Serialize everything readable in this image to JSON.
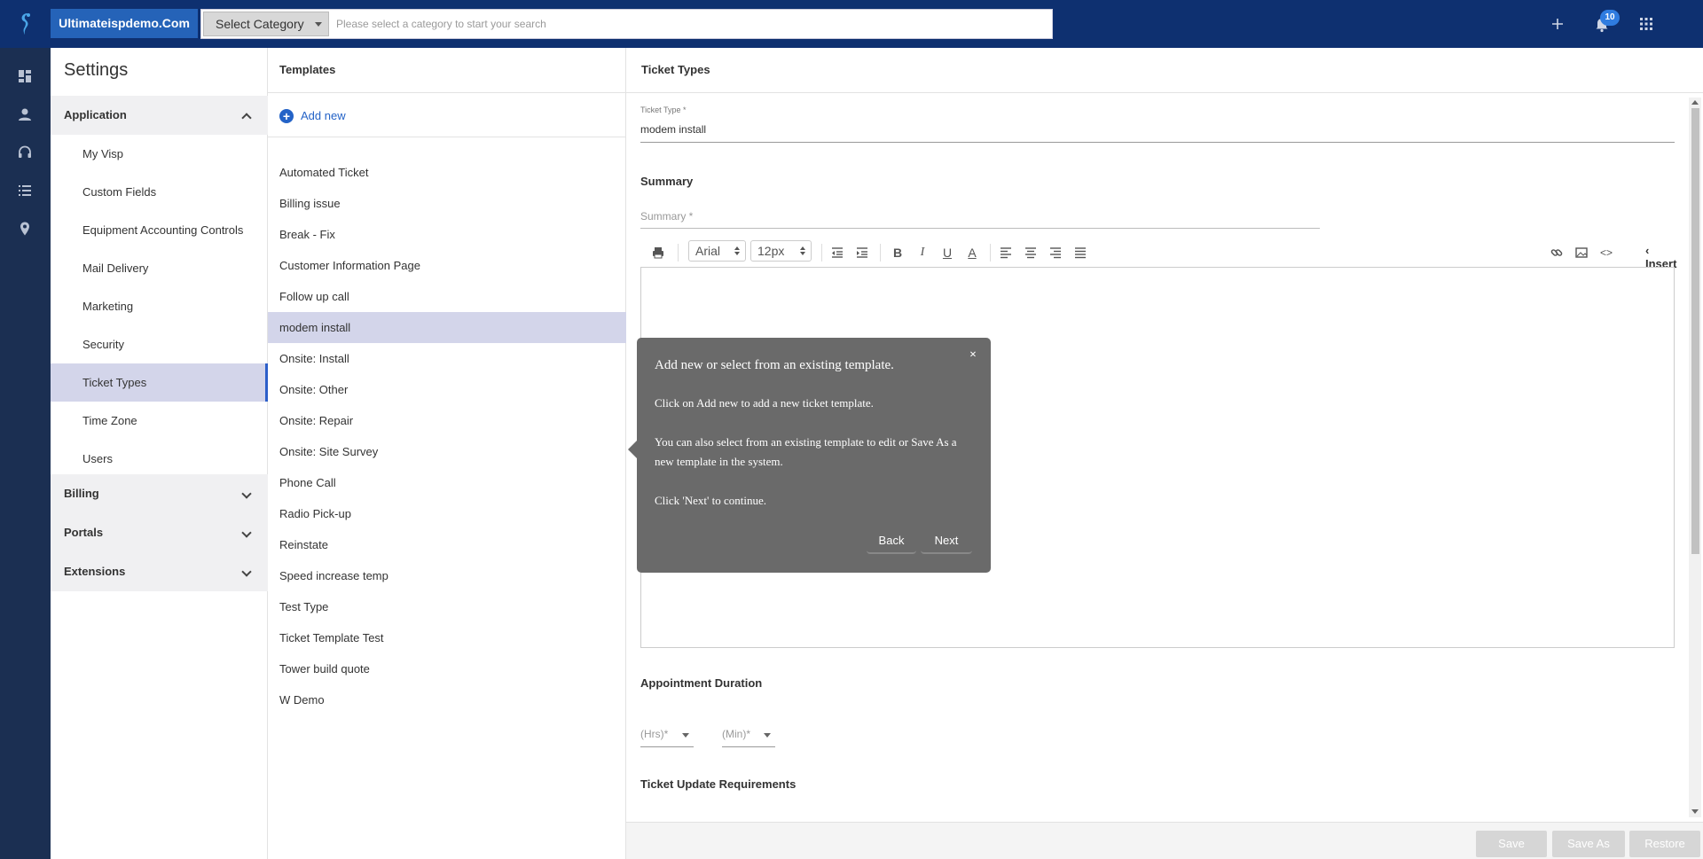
{
  "topbar": {
    "brand": "Ultimateispdemo.Com",
    "category_select": "Select Category",
    "search_placeholder": "Please select a category to start your search",
    "notification_count": "10"
  },
  "settings": {
    "title": "Settings",
    "sections": [
      {
        "label": "Application",
        "expanded": true
      },
      {
        "label": "Billing",
        "expanded": false
      },
      {
        "label": "Portals",
        "expanded": false
      },
      {
        "label": "Extensions",
        "expanded": false
      }
    ],
    "application_items": [
      {
        "label": "My Visp"
      },
      {
        "label": "Custom Fields"
      },
      {
        "label": "Equipment Accounting Controls"
      },
      {
        "label": "Mail Delivery"
      },
      {
        "label": "Marketing"
      },
      {
        "label": "Security"
      },
      {
        "label": "Ticket Types",
        "active": true
      },
      {
        "label": "Time Zone"
      },
      {
        "label": "Users"
      }
    ]
  },
  "templates": {
    "title": "Templates",
    "add_new": "Add new",
    "items": [
      "Automated Ticket",
      "Billing issue",
      "Break - Fix",
      "Customer Information Page",
      "Follow up call",
      "modem install",
      "Onsite: Install",
      "Onsite: Other",
      "Onsite: Repair",
      "Onsite: Site Survey",
      "Phone Call",
      "Radio Pick-up",
      "Reinstate",
      "Speed increase temp",
      "Test Type",
      "Ticket Template Test",
      "Tower build quote",
      "W Demo"
    ],
    "selected": "modem install"
  },
  "main": {
    "title": "Ticket Types",
    "ticket_type_label": "Ticket Type *",
    "ticket_type_value": "modem install",
    "summary_heading": "Summary",
    "summary_placeholder": "Summary *",
    "toolbar": {
      "font": "Arial",
      "size": "12px",
      "insert": "Insert"
    },
    "appointment_heading": "Appointment Duration",
    "hrs_placeholder": "(Hrs)*",
    "min_placeholder": "(Min)*",
    "update_heading": "Ticket Update Requirements",
    "buttons": {
      "save": "Save",
      "save_as": "Save As",
      "restore": "Restore"
    }
  },
  "tour": {
    "title": "Add new or select from an existing template.",
    "line1": "Click on Add new to add a new ticket template.",
    "line2": "You can also select from an existing template to edit or Save As a new template in the system.",
    "line3": "Click 'Next' to continue.",
    "close": "×",
    "back": "Back",
    "next": "Next"
  }
}
